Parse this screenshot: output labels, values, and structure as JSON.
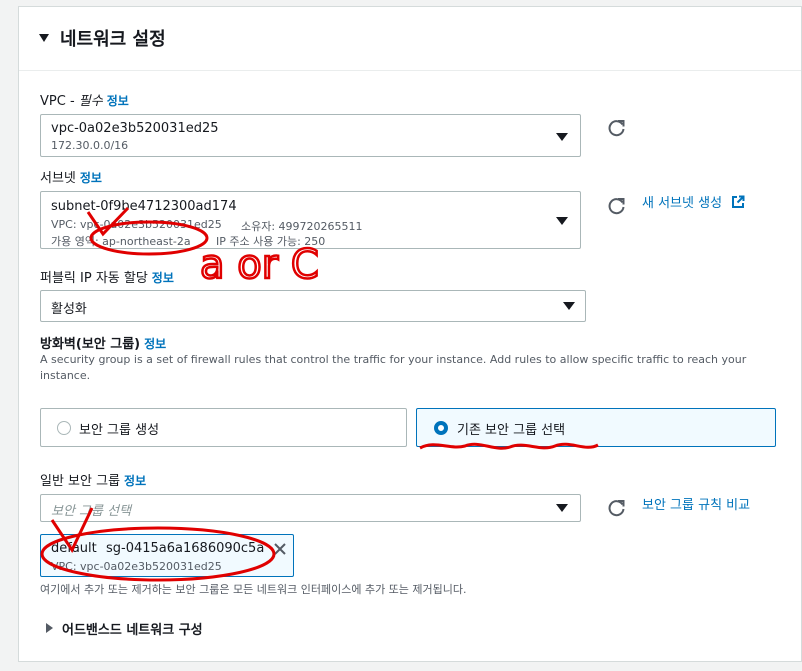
{
  "section": {
    "title": "네트워크 설정"
  },
  "vpc": {
    "label": "VPC - ",
    "required": "필수",
    "info": "정보",
    "value": "vpc-0a02e3b520031ed25",
    "cidr": "172.30.0.0/16"
  },
  "subnet": {
    "label": "서브넷",
    "info": "정보",
    "value": "subnet-0f9be4712300ad174",
    "vpc_line": "VPC: vpc-0a02e3b520031ed25",
    "owner": "소유자: 499720265511",
    "az": "가용 영역: ap-northeast-2a",
    "ip_available": "IP 주소 사용 가능: 250",
    "create_link": "새 서브넷 생성"
  },
  "public_ip": {
    "label": "퍼블릭 IP 자동 할당",
    "info": "정보",
    "value": "활성화"
  },
  "firewall": {
    "label": "방화벽(보안 그룹)",
    "info": "정보",
    "description": "A security group is a set of firewall rules that control the traffic for your instance. Add rules to allow specific traffic to reach your instance.",
    "option_create": "보안 그룹 생성",
    "option_existing": "기존 보안 그룹 선택"
  },
  "common_sg": {
    "label": "일반 보안 그룹",
    "info": "정보",
    "placeholder": "보안 그룹 선택",
    "compare_link": "보안 그룹 규칙 비교",
    "token_name": "default",
    "token_id": "sg-0415a6a1686090c5a",
    "token_vpc": "VPC: vpc-0a02e3b520031ed25",
    "note": "여기에서 추가 또는 제거하는 보안 그룹은 모든 네트워크 인터페이스에 추가 또는 제거됩니다."
  },
  "advanced": {
    "label": "어드밴스드 네트워크 구성"
  },
  "annotation": {
    "text": "a or C",
    "color": "#e00000"
  }
}
